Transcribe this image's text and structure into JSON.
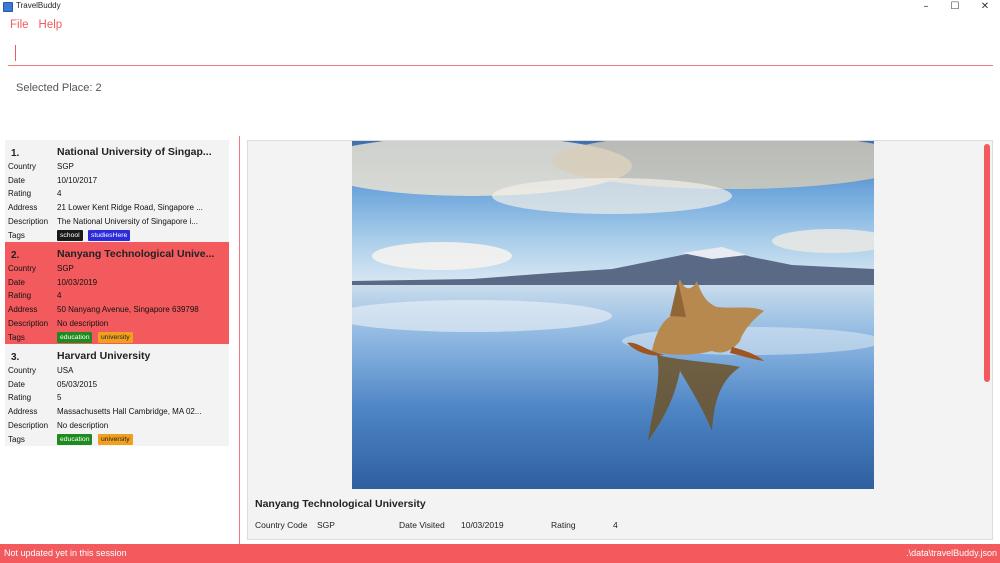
{
  "window": {
    "title": "TravelBuddy",
    "minimize_glyph": "–",
    "maximize_glyph": "☐",
    "close_glyph": "✕"
  },
  "menu": {
    "file": "File",
    "help": "Help"
  },
  "command_box": {
    "value": ""
  },
  "result": {
    "text": "Selected Place: 2"
  },
  "labels": {
    "country": "Country",
    "date": "Date",
    "rating": "Rating",
    "address": "Address",
    "description": "Description",
    "tags": "Tags"
  },
  "places": [
    {
      "index": "1.",
      "name": "National University of Singap...",
      "country": "SGP",
      "date": "10/10/2017",
      "rating": "4",
      "address": "21 Lower Kent Ridge Road, Singapore ...",
      "description": "The National University of Singapore i...",
      "tags": [
        {
          "label": "school",
          "color": "#1a1a1a"
        },
        {
          "label": "studiesHere",
          "color": "#2b2bd9"
        }
      ]
    },
    {
      "index": "2.",
      "name": "Nanyang Technological Unive...",
      "country": "SGP",
      "date": "10/03/2019",
      "rating": "4",
      "address": "50 Nanyang Avenue, Singapore 639798",
      "description": "No description",
      "tags": [
        {
          "label": "education",
          "color": "#1f8a1f"
        },
        {
          "label": "university",
          "color": "#f0a01e"
        }
      ]
    },
    {
      "index": "3.",
      "name": "Harvard University",
      "country": "USA",
      "date": "05/03/2015",
      "rating": "5",
      "address": "Massachusetts Hall Cambridge, MA 02...",
      "description": "No description",
      "tags": [
        {
          "label": "education",
          "color": "#1f8a1f"
        },
        {
          "label": "university",
          "color": "#f0a01e"
        }
      ]
    }
  ],
  "detail": {
    "name": "Nanyang Technological University",
    "country_code_label": "Country Code",
    "country_code": "SGP",
    "date_visited_label": "Date Visited",
    "date_visited": "10/03/2019",
    "rating_label": "Rating",
    "rating": "4"
  },
  "status": {
    "left": "Not updated yet in this session",
    "right": ".\\data\\travelBuddy.json"
  },
  "colors": {
    "accent": "#f35a5e",
    "card_bg": "#f3f3f3"
  }
}
